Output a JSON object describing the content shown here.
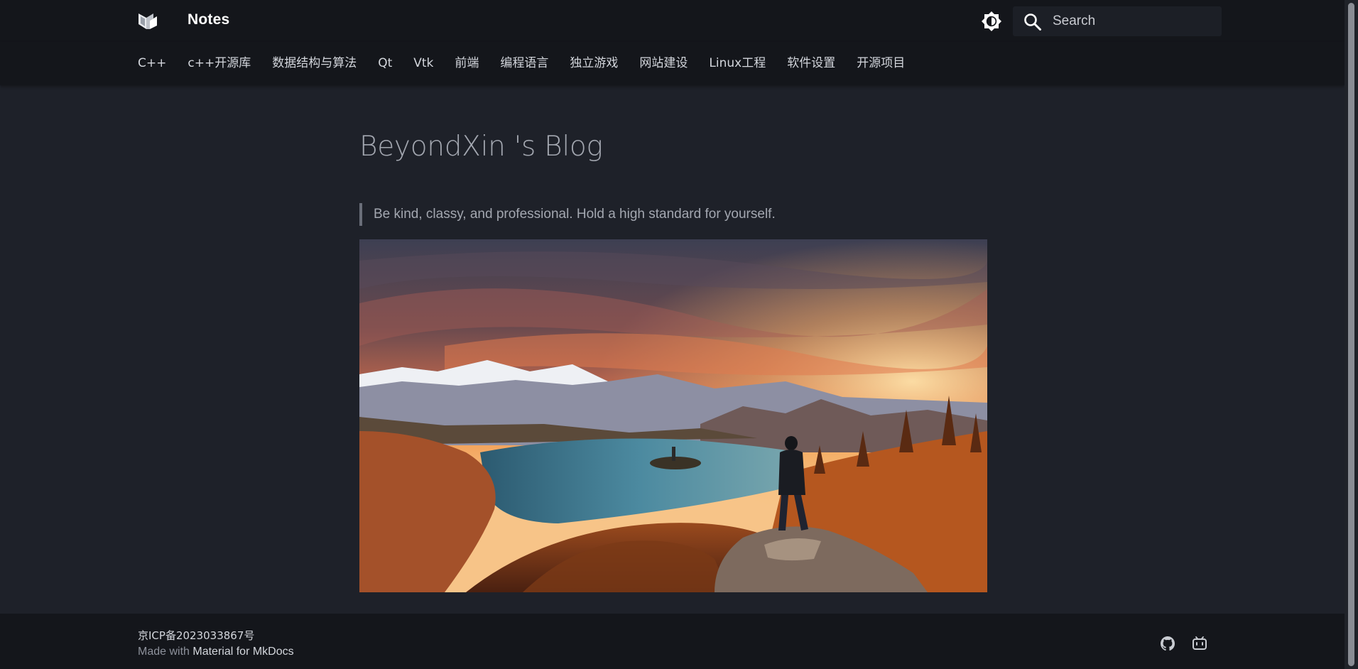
{
  "header": {
    "site_title": "Notes",
    "logo_icon": "material-mkdocs-logo-icon",
    "theme_toggle_icon": "brightness-icon",
    "search": {
      "placeholder": "Search",
      "value": "",
      "icon": "search-icon"
    }
  },
  "tabs": [
    {
      "label": "C++"
    },
    {
      "label": "c++开源库"
    },
    {
      "label": "数据结构与算法"
    },
    {
      "label": "Qt"
    },
    {
      "label": "Vtk"
    },
    {
      "label": "前端"
    },
    {
      "label": "编程语言"
    },
    {
      "label": "独立游戏"
    },
    {
      "label": "网站建设"
    },
    {
      "label": "Linux工程"
    },
    {
      "label": "软件设置"
    },
    {
      "label": "开源项目"
    }
  ],
  "main": {
    "title": "BeyondXin 's Blog",
    "quote": "Be kind, classy, and professional. Hold a high standard for yourself."
  },
  "footer": {
    "icp": "京ICP备2023033867号",
    "made_with_prefix": "Made with",
    "made_with_link": "Material for MkDocs",
    "social": [
      {
        "icon": "github-icon"
      },
      {
        "icon": "bilibili-icon"
      }
    ]
  },
  "colors": {
    "page_background": "#1e2129",
    "header_background": "#14161b",
    "title_text": "#a3a7b0",
    "quote_border": "#6a6e79"
  }
}
